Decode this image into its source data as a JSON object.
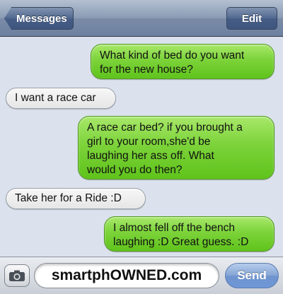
{
  "nav": {
    "back_label": "Messages",
    "edit_label": "Edit"
  },
  "messages": [
    {
      "direction": "sent",
      "lines": [
        "What kind of bed do you want",
        "for the new house?"
      ]
    },
    {
      "direction": "received",
      "lines": [
        "I want a race car"
      ]
    },
    {
      "direction": "sent",
      "lines": [
        "A race car bed? if you brought a",
        "girl to your room,she'd be",
        "laughing her ass off. What",
        "would you do then?"
      ]
    },
    {
      "direction": "received",
      "lines": [
        "Take her for a Ride :D"
      ]
    },
    {
      "direction": "sent",
      "lines": [
        "I almost fell off the bench",
        "laughing :D Great guess. :D"
      ]
    }
  ],
  "composer": {
    "input_text": "smartphOWNED.com",
    "send_label": "Send",
    "camera_icon": "camera-icon"
  },
  "colors": {
    "sent_bubble": "#7cd33a",
    "received_bubble": "#e6e6e6",
    "background": "#dbe2ed",
    "navbar": "#7a8ca7"
  }
}
